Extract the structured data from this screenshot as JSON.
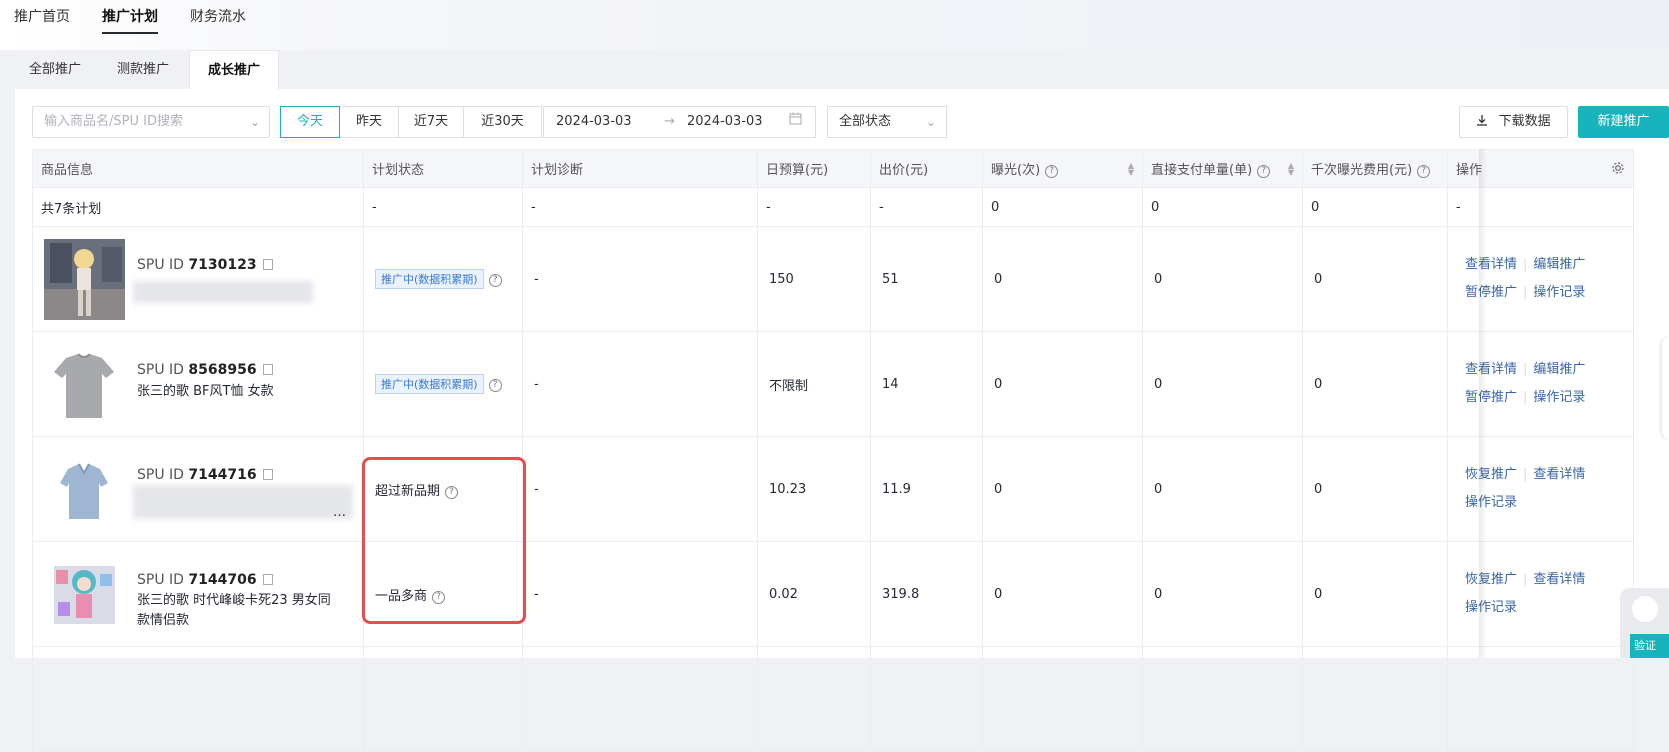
{
  "topnav": {
    "items": [
      "推广首页",
      "推广计划",
      "财务流水"
    ]
  },
  "subtabs": [
    "全部推广",
    "测款推广",
    "成长推广"
  ],
  "filters": {
    "search_placeholder": "输入商品名/SPU ID搜索",
    "date_buttons": [
      "今天",
      "昨天",
      "近7天",
      "近30天"
    ],
    "date_start": "2024-03-03",
    "date_end": "2024-03-03",
    "status_select": "全部状态",
    "download_label": "下载数据",
    "new_label": "新建推广"
  },
  "table": {
    "headers": [
      "商品信息",
      "计划状态",
      "计划诊断",
      "日预算(元)",
      "出价(元)",
      "曝光(次)",
      "直接支付单量(单)",
      "千次曝光费用(元)",
      "操作"
    ],
    "summary": [
      "共7条计划",
      "-",
      "-",
      "-",
      "-",
      "0",
      "0",
      "0",
      "-"
    ],
    "rows": [
      {
        "spu_prefix": "SPU ID",
        "spu_id": "7130123",
        "name_line1": "",
        "name_line2": "",
        "status": "推广中(数据积累期)",
        "diagnosis": "-",
        "budget": "150",
        "bid": "51",
        "exposure": "0",
        "orders": "0",
        "cpm": "0",
        "ops": [
          "查看详情",
          "编辑推广",
          "暂停推广",
          "操作记录"
        ]
      },
      {
        "spu_prefix": "SPU ID",
        "spu_id": "8568956",
        "name_line1": "张三的歌 BF风T恤 女款",
        "name_line2": "",
        "status": "推广中(数据积累期)",
        "diagnosis": "-",
        "budget": "不限制",
        "bid": "14",
        "exposure": "0",
        "orders": "0",
        "cpm": "0",
        "ops": [
          "查看详情",
          "编辑推广",
          "暂停推广",
          "操作记录"
        ]
      },
      {
        "spu_prefix": "SPU ID",
        "spu_id": "7144716",
        "name_line1": "…",
        "name_line2": "",
        "status": "超过新品期",
        "diagnosis": "-",
        "budget": "10.23",
        "bid": "11.9",
        "exposure": "0",
        "orders": "0",
        "cpm": "0",
        "ops": [
          "恢复推广",
          "查看详情",
          "操作记录"
        ]
      },
      {
        "spu_prefix": "SPU ID",
        "spu_id": "7144706",
        "name_line1": "张三的歌 时代峰峻卡死23 男女同",
        "name_line2": "款情侣款",
        "status": "一品多商",
        "diagnosis": "-",
        "budget": "0.02",
        "bid": "319.8",
        "exposure": "0",
        "orders": "0",
        "cpm": "0",
        "ops": [
          "恢复推广",
          "查看详情",
          "操作记录"
        ]
      }
    ]
  },
  "widget": {
    "verify_label": "验证"
  },
  "colors": {
    "accent": "#18b4bd",
    "link": "#3a66a8",
    "highlight": "#e34e4e"
  }
}
